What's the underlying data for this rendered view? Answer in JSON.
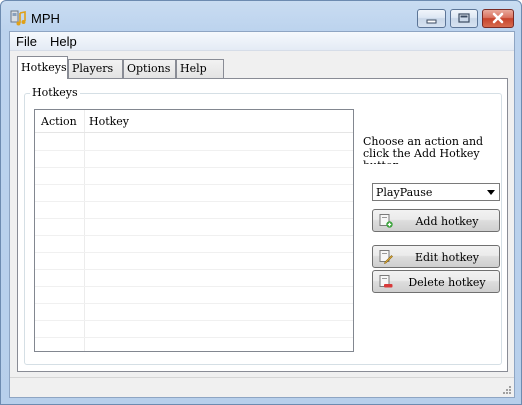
{
  "window": {
    "title": "MPH",
    "controls": [
      "minimize-icon",
      "maximize-icon",
      "close-icon"
    ]
  },
  "menu": {
    "items": [
      {
        "label": "File"
      },
      {
        "label": "Help"
      }
    ]
  },
  "tabs": [
    {
      "label": "Hotkeys",
      "active": true
    },
    {
      "label": "Players",
      "active": false
    },
    {
      "label": "Options",
      "active": false
    },
    {
      "label": "Help",
      "active": false
    }
  ],
  "hotkeys_panel": {
    "group_label": "Hotkeys",
    "table": {
      "columns": [
        "Action",
        "Hotkey"
      ],
      "rows": []
    },
    "instruction": "Choose an action and click the Add Hotkey button:",
    "action_select": {
      "value": "PlayPause"
    },
    "buttons": {
      "add": "Add hotkey",
      "edit": "Edit hotkey",
      "delete": "Delete hotkey"
    }
  },
  "statusbar": {
    "text": ""
  },
  "colors": {
    "title_bar": "#bcd3ee",
    "close_button": "#c7432b",
    "panel_background": "#f0f0f0",
    "add_icon": "#3aa23a",
    "delete_icon": "#d83a3a"
  }
}
